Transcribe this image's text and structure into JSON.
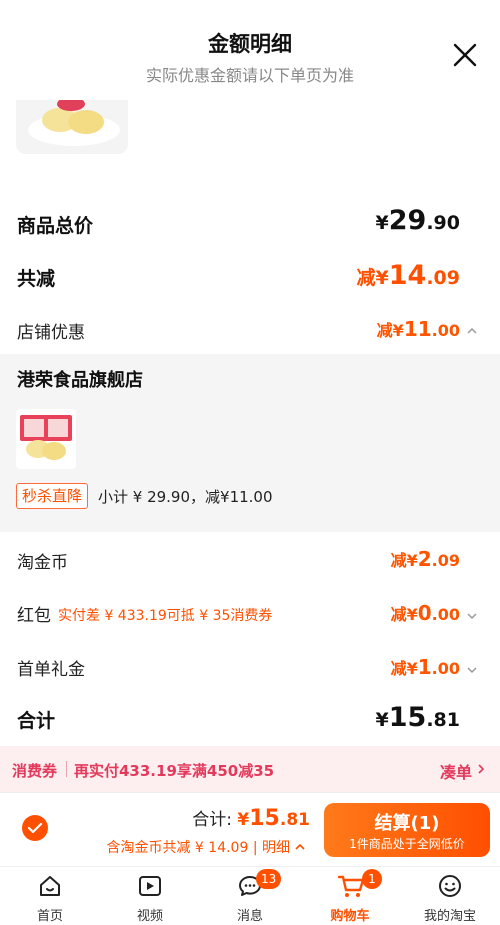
{
  "header": {
    "title": "金额明细",
    "subtitle": "实际优惠金额请以下单页为准"
  },
  "summary": {
    "total_label": "商品总价",
    "total_prefix": "¥",
    "total_int": "29",
    "total_dec": ".90",
    "reduce_label": "共减",
    "reduce_prefix": "减¥",
    "reduce_int": "14",
    "reduce_dec": ".09",
    "store_label": "店铺优惠",
    "store_prefix": "减¥",
    "store_int": "11",
    "store_dec": ".00"
  },
  "shop": {
    "name": "港荣食品旗舰店",
    "tag": "秒杀直降",
    "subtotal": "小计 ¥ 29.90，减¥11.00"
  },
  "discounts": {
    "coin_label": "淘金币",
    "coin_prefix": "减¥",
    "coin_int": "2",
    "coin_dec": ".09",
    "hongbao_label": "红包",
    "hongbao_note": "实付差 ¥ 433.19可抵 ¥ 35消费券",
    "hongbao_prefix": "减¥",
    "hongbao_int": "0",
    "hongbao_dec": ".00",
    "firstorder_label": "首单礼金",
    "firstorder_prefix": "减¥",
    "firstorder_int": "1",
    "firstorder_dec": ".00",
    "sum_label": "合计",
    "sum_prefix": "¥",
    "sum_int": "15",
    "sum_dec": ".81"
  },
  "coupon_bar": {
    "tag": "消费券",
    "text": "再实付433.19享满450减35",
    "action": "凑单"
  },
  "checkout": {
    "total_label": "合计: ",
    "total_prefix": "¥",
    "total_int": "15",
    "total_dec": ".81",
    "sub_text": "含淘金币共减 ¥ 14.09 | ",
    "detail_link": "明细",
    "pay_label": "结算(1)",
    "pay_sub": "1件商品处于全网低价"
  },
  "tabbar": {
    "tabs": [
      {
        "label": "首页",
        "icon": "home-icon"
      },
      {
        "label": "视频",
        "icon": "video-icon"
      },
      {
        "label": "消息",
        "icon": "message-icon",
        "badge": "13"
      },
      {
        "label": "购物车",
        "icon": "cart-icon",
        "badge": "1",
        "active": true
      },
      {
        "label": "我的淘宝",
        "icon": "profile-icon"
      }
    ]
  },
  "colors": {
    "accent": "#ff5000",
    "coupon": "#e33a5c",
    "panel": "#f5f5f5"
  }
}
